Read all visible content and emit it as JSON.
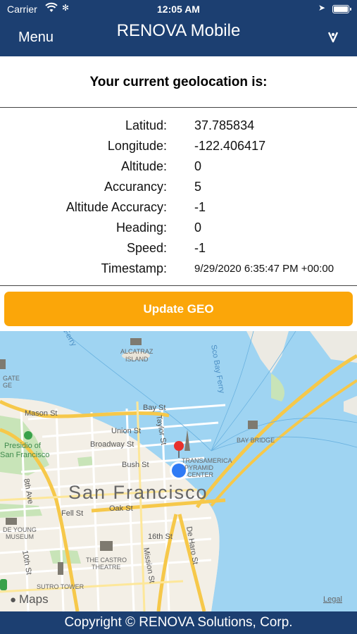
{
  "status_bar": {
    "carrier": "Carrier",
    "time": "12:05 AM"
  },
  "nav": {
    "menu_label": "Menu",
    "title": "RENOVA Mobile"
  },
  "heading": "Your current geolocation is:",
  "geo": [
    {
      "label": "Latitud:",
      "value": "37.785834"
    },
    {
      "label": "Longitude:",
      "value": "-122.406417"
    },
    {
      "label": "Altitude:",
      "value": "0"
    },
    {
      "label": "Accurancy:",
      "value": "5"
    },
    {
      "label": "Altitude Accuracy:",
      "value": "-1"
    },
    {
      "label": "Heading:",
      "value": "0"
    },
    {
      "label": "Speed:",
      "value": "-1"
    },
    {
      "label": "Timestamp:",
      "value": "9/29/2020 6:35:47 PM +00:00"
    }
  ],
  "update_button": "Update GEO",
  "map": {
    "city": "San Francisco",
    "labels": {
      "bay_st": "Bay St",
      "union_st": "Union St",
      "broadway_st": "Broadway St",
      "bush_st": "Bush St",
      "oak_st": "Oak St",
      "fell_st": "Fell St",
      "mason_st": "Mason St",
      "taylor_st": "Taylor St",
      "st_16th": "16th St",
      "ave_8th": "8th Ave",
      "st_10th": "10th St",
      "mission_st": "Mission St",
      "de_haro_st": "De Haro St",
      "alcatraz_line1": "ALCATRAZ",
      "alcatraz_line2": "ISLAND",
      "presidio_line1": "Presidio of",
      "presidio_line2": "San Francisco",
      "bay_bridge": "BAY BRIDGE",
      "de_young_line1": "DE YOUNG",
      "de_young_line2": "MUSEUM",
      "castro_line1": "THE CASTRO",
      "castro_line2": "THEATRE",
      "sutro_tower": "SUTRO TOWER",
      "transamerica_line1": "TRANSAMERICA",
      "transamerica_line2": "PYRAMID",
      "transamerica_line3": "CENTER",
      "gate_line1": "GATE",
      "gate_line2": "GE",
      "ferry_1": "Ferry",
      "ferry_2": "Sco Bay Ferry",
      "maps_brand": "Maps",
      "legal": "Legal"
    }
  },
  "footer": "Copyright © RENOVA Solutions, Corp.",
  "colors": {
    "nav_bg": "#1c3f71",
    "button": "#fba609",
    "water": "#9fd4f2",
    "land": "#f3efe6",
    "park": "#c8e4b8",
    "highway": "#f6c84a",
    "pin_red": "#e8312c",
    "user_dot": "#2f7bf5"
  }
}
